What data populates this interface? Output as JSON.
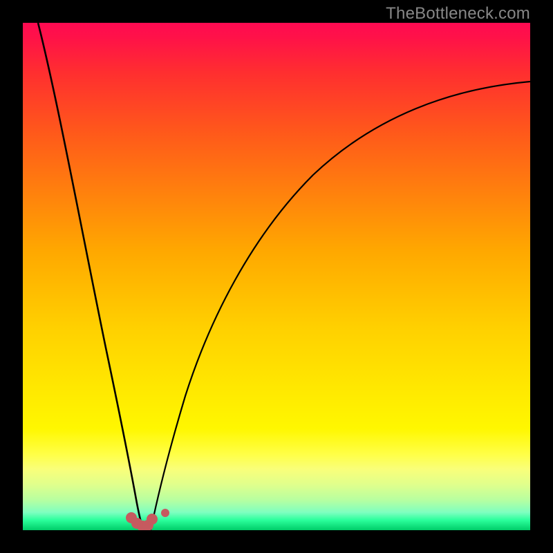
{
  "attribution": "TheBottleneck.com",
  "colors": {
    "gradient_top": "#ff0a52",
    "gradient_mid": "#ffd000",
    "gradient_bottom": "#00cc68",
    "curve": "#000000",
    "marker": "#c65a5f",
    "frame": "#000000",
    "attribution_text": "#878787"
  },
  "chart_data": {
    "type": "line",
    "title": "",
    "xlabel": "",
    "ylabel": "",
    "xlim": [
      0,
      100
    ],
    "ylim": [
      0,
      100
    ],
    "series": [
      {
        "name": "left-curve",
        "x": [
          3,
          5,
          7,
          9,
          11,
          13,
          15,
          17,
          18,
          19,
          20,
          21,
          22,
          23
        ],
        "y": [
          100,
          87,
          75,
          63,
          52,
          41,
          31,
          21,
          16,
          11,
          7,
          4,
          2,
          0
        ]
      },
      {
        "name": "right-curve",
        "x": [
          25,
          27,
          30,
          34,
          38,
          43,
          48,
          54,
          60,
          67,
          74,
          81,
          88,
          95,
          100
        ],
        "y": [
          0,
          10,
          22,
          34,
          44,
          53,
          60,
          67,
          72,
          77,
          80,
          83,
          85,
          87,
          88
        ]
      }
    ],
    "markers": {
      "name": "bottom-cluster",
      "points_xy": [
        [
          21.5,
          2.5
        ],
        [
          22.5,
          1.2
        ],
        [
          23.5,
          0.7
        ],
        [
          24.5,
          0.9
        ],
        [
          25.3,
          2.2
        ],
        [
          28.0,
          3.4
        ]
      ],
      "radius_px": 7
    },
    "note": "Axis units are implied percentages; values estimated from pixel positions against a 734x734 plot area, origin at bottom-left."
  }
}
